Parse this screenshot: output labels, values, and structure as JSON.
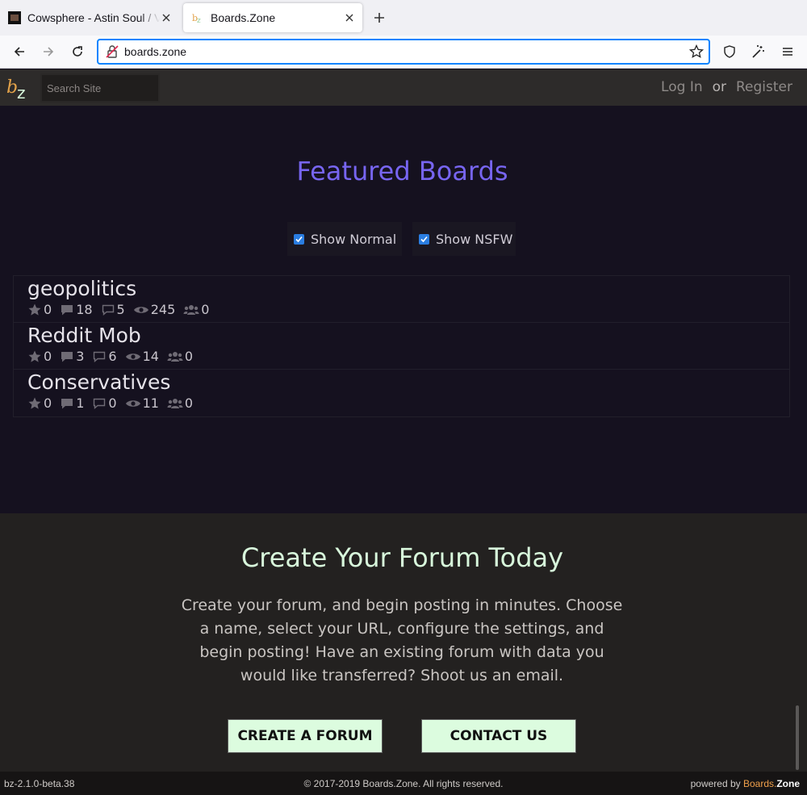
{
  "browser": {
    "tabs": [
      {
        "title": "Cowsphere - Astin Soul / Vix",
        "active": false
      },
      {
        "title": "Boards.Zone",
        "active": true
      }
    ],
    "url": "boards.zone"
  },
  "header": {
    "search_placeholder": "Search Site",
    "login": "Log In",
    "or": "or",
    "register": "Register"
  },
  "featured": {
    "title": "Featured Boards",
    "filters": {
      "normal": "Show Normal",
      "nsfw": "Show NSFW"
    },
    "boards": [
      {
        "name": "geopolitics",
        "stars": "0",
        "posts": "18",
        "threads": "5",
        "views": "245",
        "members": "0"
      },
      {
        "name": "Reddit Mob",
        "stars": "0",
        "posts": "3",
        "threads": "6",
        "views": "14",
        "members": "0"
      },
      {
        "name": "Conservatives",
        "stars": "0",
        "posts": "1",
        "threads": "0",
        "views": "11",
        "members": "0"
      }
    ]
  },
  "create": {
    "title": "Create Your Forum Today",
    "text": "Create your forum, and begin posting in minutes. Choose a name, select your URL, configure the settings, and begin posting! Have an existing forum with data you would like transferred? Shoot us an email.",
    "create_btn": "CREATE A FORUM",
    "contact_btn": "CONTACT US"
  },
  "footer": {
    "version": "bz-2.1.0-beta.38",
    "copyright": "© 2017-2019 Boards.Zone. All rights reserved.",
    "powered_by": "powered by ",
    "brand_part1": "Boards.",
    "brand_part2": "Zone"
  },
  "colors": {
    "accent_purple": "#7765f0",
    "accent_green": "#dcfcdf",
    "brand_orange": "#f0a04b"
  }
}
